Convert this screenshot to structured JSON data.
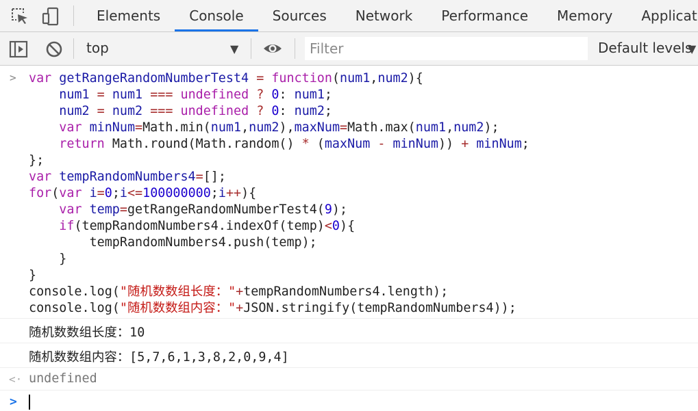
{
  "tabs": [
    {
      "label": "Elements",
      "active": false
    },
    {
      "label": "Console",
      "active": true
    },
    {
      "label": "Sources",
      "active": false
    },
    {
      "label": "Network",
      "active": false
    },
    {
      "label": "Performance",
      "active": false
    },
    {
      "label": "Memory",
      "active": false
    },
    {
      "label": "Application",
      "active": false
    }
  ],
  "icons": {
    "inspect": "cursor-select-icon",
    "device": "device-toggle-icon",
    "sidebar": "sidebar-toggle-icon",
    "clear": "clear-console-icon",
    "eye": "live-expression-icon",
    "dropdown": "chevron-down-icon"
  },
  "toolbar": {
    "context": "top",
    "filter_placeholder": "Filter",
    "filter_value": "",
    "levels": "Default levels"
  },
  "console": {
    "outputs": [
      "随机数数组长度：10",
      "随机数数组内容：[5,7,6,1,3,8,2,0,9,4]"
    ],
    "return_value": "undefined"
  },
  "colors": {
    "accent": "#1a73e8",
    "keyword": "#a91ea9",
    "variable": "#1a1aa6",
    "operator": "#a62b2b",
    "number": "#1c00cf",
    "string": "#c41a16"
  }
}
